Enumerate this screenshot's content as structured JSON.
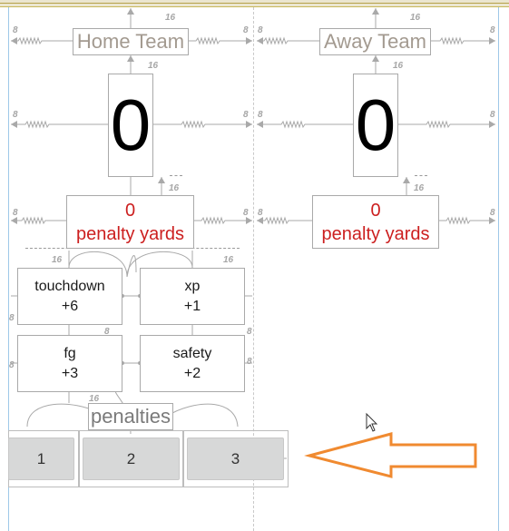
{
  "home": {
    "team_label": "Home Team",
    "score": "0",
    "penalty_value": "0",
    "penalty_label": "penalty yards"
  },
  "away": {
    "team_label": "Away Team",
    "score": "0",
    "penalty_value": "0",
    "penalty_label": "penalty yards"
  },
  "actions": {
    "touchdown": {
      "label": "touchdown",
      "points": "+6"
    },
    "xp": {
      "label": "xp",
      "points": "+1"
    },
    "fg": {
      "label": "fg",
      "points": "+3"
    },
    "safety": {
      "label": "safety",
      "points": "+2"
    }
  },
  "penalties": {
    "label": "penalties",
    "tabs": [
      "1",
      "2",
      "3"
    ]
  },
  "constraint_margins": {
    "m8": "8",
    "m16": "16"
  },
  "colors": {
    "penalty_red": "#cc1f1f",
    "arrow_orange": "#f08a30",
    "constraint_gray": "#a6a6a6"
  }
}
